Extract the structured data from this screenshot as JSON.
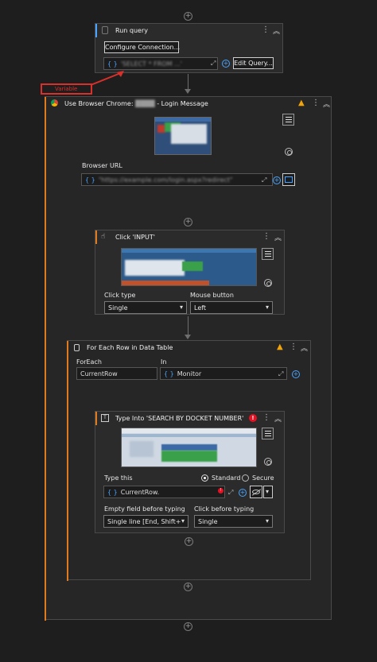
{
  "run_query": {
    "title": "Run query",
    "configure_label": "Configure Connection...",
    "edit_query_label": "Edit Query...",
    "query_value": "'SELECT * FROM ...'"
  },
  "annotation": {
    "label": "Variable"
  },
  "browser": {
    "title": "Use Browser Chrome:",
    "title_masked": "████",
    "title_suffix": "- Login Message",
    "url_label": "Browser URL",
    "url_value": "\"https://example.com/login.aspx?redirect\""
  },
  "click": {
    "title": "Click 'INPUT'",
    "click_type_label": "Click type",
    "click_type_value": "Single",
    "mouse_button_label": "Mouse button",
    "mouse_button_value": "Left"
  },
  "foreach": {
    "title": "For Each Row in Data Table",
    "foreach_label": "ForEach",
    "foreach_value": "CurrentRow",
    "in_label": "In",
    "in_value": "Monitor"
  },
  "type_into": {
    "title": "Type Into 'SEARCH BY DOCKET NUMBER'",
    "type_this_label": "Type this",
    "standard_label": "Standard",
    "secure_label": "Secure",
    "type_value": "CurrentRow.",
    "empty_field_label": "Empty field before typing",
    "empty_field_value": "Single line [End, Shift+H",
    "click_before_label": "Click before typing",
    "click_before_value": "Single"
  },
  "icons": {
    "plus": "+",
    "kebab": "⋮",
    "collapse": "︽",
    "warning": "▲",
    "error": "!",
    "chevron": "▾",
    "expand": "⤢"
  },
  "colors": {
    "accent_blue": "#4aa3ff",
    "warning": "#f0a30a",
    "error": "#e81123",
    "scope_orange": "#e07a1f",
    "annotation_red": "#d9302b"
  }
}
